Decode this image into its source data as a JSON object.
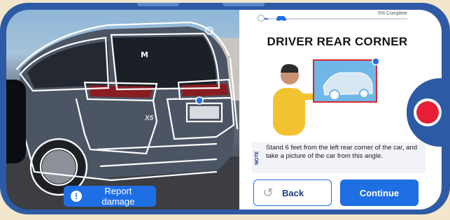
{
  "progress": {
    "label": "5% Complete",
    "value": 0.05
  },
  "step": {
    "title": "DRIVER REAR CORNER"
  },
  "camera": {
    "badge_model": "X5",
    "report_label": "Report damage"
  },
  "note": {
    "label": "NOTE",
    "text": "Stand 6 feet from the left rear corner of the car, and take a picture of the car from this angle."
  },
  "actions": {
    "back_label": "Back",
    "continue_label": "Continue"
  },
  "icons": {
    "report": "alert-icon",
    "back": "undo-icon",
    "progress_car": "car-icon",
    "shutter": "shutter-icon"
  },
  "colors": {
    "accent": "#1f6fe4",
    "frame": "#2d5aa5",
    "shutter": "#e61e36",
    "background": "#f2e7cc"
  }
}
